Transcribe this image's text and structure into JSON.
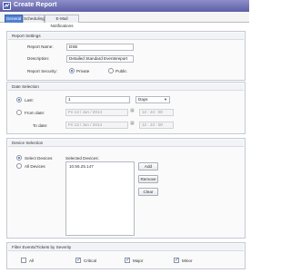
{
  "window": {
    "title": "Create Report"
  },
  "tabs": [
    {
      "label": "General"
    },
    {
      "label": "Scheduling"
    },
    {
      "label": "E-Mail Notifications"
    }
  ],
  "report_settings": {
    "section_title": "Report Settings",
    "name_label": "Report Name:",
    "name_value": "DSE",
    "description_label": "Description:",
    "description_value": "Detailed Standard Eventsreport",
    "security_label": "Report Security:",
    "private_label": "Private",
    "public_label": "Public"
  },
  "date_selection": {
    "section_title": "Date Selection",
    "last_label": "Last:",
    "last_value": "1",
    "unit_value": "Days",
    "from_label": "From date:",
    "from_date": "Fri 13 / Jun / 2014",
    "from_time": "12 : 24 : 00",
    "to_label": "To date:",
    "to_date": "Fri 13 / Jun / 2014",
    "to_time": "12 : 24 : 00"
  },
  "device_selection": {
    "section_title": "Device Selection",
    "select_devices_label": "Select Devices",
    "all_devices_label": "All Devices",
    "selected_header": "Selected Devices:",
    "selected_items": [
      "10.56.25.147"
    ],
    "add_label": "Add",
    "remove_label": "Remove",
    "clear_label": "Clear"
  },
  "severity_filter": {
    "section_title": "Filter Events/Tickets by Severity",
    "items": [
      {
        "label": "All",
        "checked": false
      },
      {
        "label": "Critical",
        "checked": true
      },
      {
        "label": "Major",
        "checked": true
      },
      {
        "label": "Minor",
        "checked": true
      }
    ]
  },
  "colors": {
    "titlebar": "#6b6cae",
    "active_tab": "#4f7fd1"
  }
}
